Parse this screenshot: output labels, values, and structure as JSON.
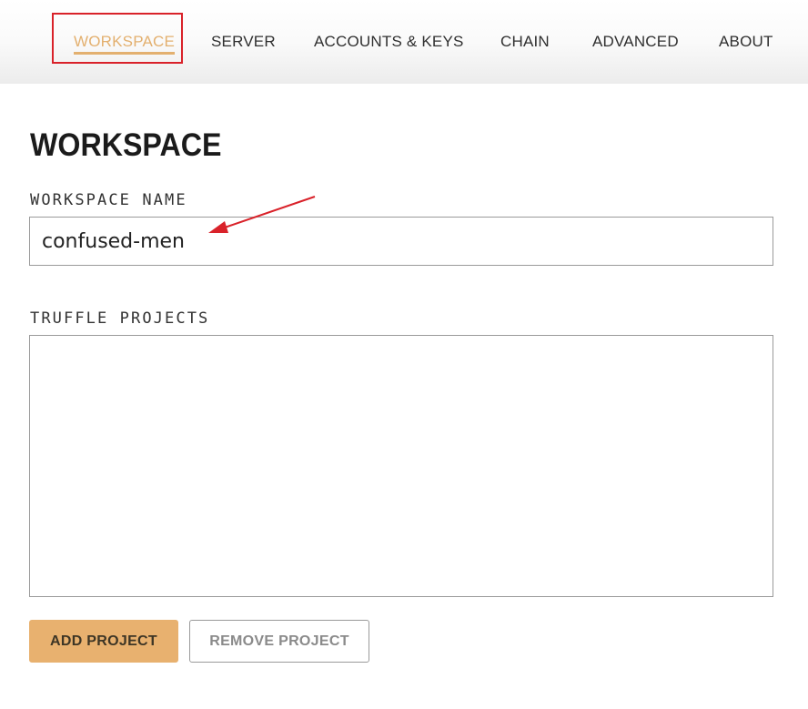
{
  "nav": {
    "tabs": [
      {
        "label": "WORKSPACE",
        "active": true
      },
      {
        "label": "SERVER",
        "active": false
      },
      {
        "label": "ACCOUNTS & KEYS",
        "active": false
      },
      {
        "label": "CHAIN",
        "active": false
      },
      {
        "label": "ADVANCED",
        "active": false
      },
      {
        "label": "ABOUT",
        "active": false
      }
    ]
  },
  "page": {
    "title": "WORKSPACE"
  },
  "workspace_name": {
    "label": "WORKSPACE NAME",
    "value": "confused-men"
  },
  "truffle_projects": {
    "label": "TRUFFLE PROJECTS",
    "items": []
  },
  "buttons": {
    "add_project": "ADD PROJECT",
    "remove_project": "REMOVE PROJECT"
  },
  "colors": {
    "accent": "#e8b16f",
    "annotation_red": "#d9222a"
  }
}
